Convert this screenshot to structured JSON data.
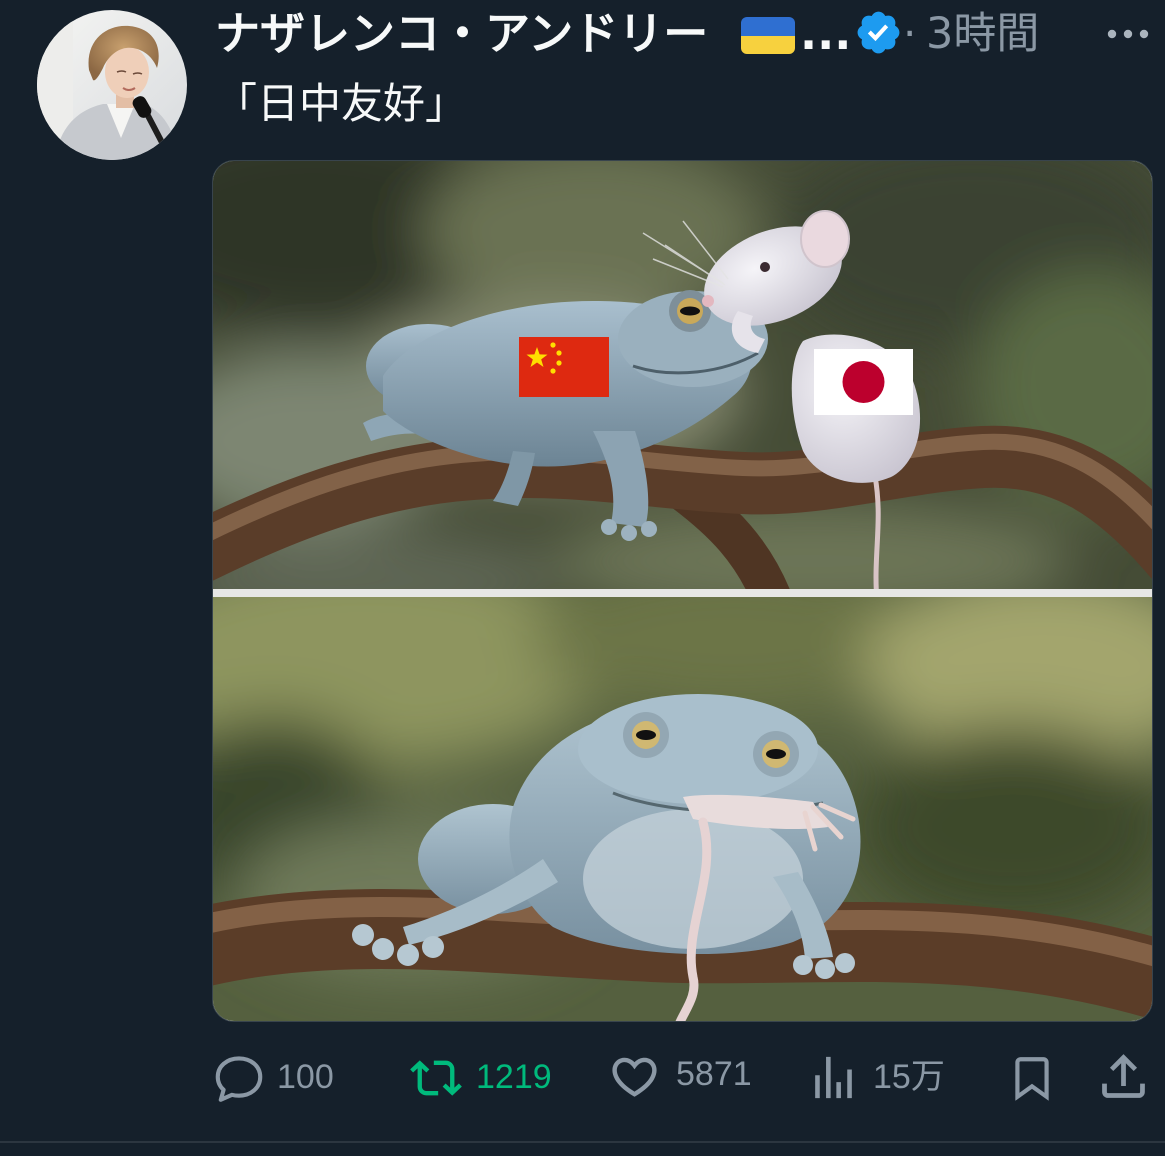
{
  "theme": {
    "background": "#15202b",
    "text": "#f7f9f9",
    "muted": "#8b98a5",
    "retweet_active": "#00ba7c",
    "verified": "#1d9bf0",
    "border": "#38444d"
  },
  "author": {
    "display_name": "ナザレンコ・アンドリー",
    "flag_icon": "ukraine-flag-icon",
    "name_truncation": "...",
    "verified_icon": "verified-badge-icon",
    "avatar_icon": "avatar"
  },
  "meta": {
    "separator": "·",
    "time": "3時間",
    "more_icon": "more-icon"
  },
  "tweet": {
    "text": "「日中友好」"
  },
  "media": {
    "overlay_icons": [
      "china-flag-icon",
      "japan-flag-icon"
    ]
  },
  "actions": {
    "reply": {
      "icon": "reply-icon",
      "count": "100"
    },
    "retweet": {
      "icon": "retweet-icon",
      "count": "1219",
      "active": true
    },
    "like": {
      "icon": "heart-icon",
      "count": "5871"
    },
    "views": {
      "icon": "analytics-icon",
      "count": "15万"
    },
    "bookmark": {
      "icon": "bookmark-icon"
    },
    "share": {
      "icon": "share-icon"
    }
  }
}
